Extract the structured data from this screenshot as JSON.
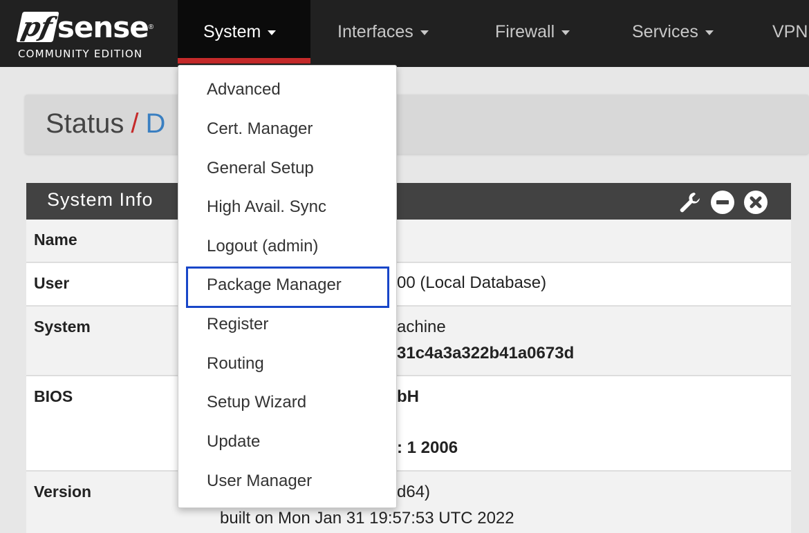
{
  "logo": {
    "pf": "pf",
    "sense": "sense",
    "reg": "®",
    "edition": "COMMUNITY EDITION"
  },
  "nav": {
    "system": "System",
    "interfaces": "Interfaces",
    "firewall": "Firewall",
    "services": "Services",
    "vpn": "VPN"
  },
  "breadcrumb": {
    "section": "Status",
    "separator": "/",
    "current": "D"
  },
  "sysinfo": {
    "title": "System Info",
    "rows": {
      "name": {
        "label": "Name"
      },
      "user": {
        "label": "User",
        "value": "00 (Local Database)"
      },
      "system": {
        "label": "System",
        "value1": "achine",
        "value2": "31c4a3a322b41a0673d"
      },
      "bios": {
        "label": "BIOS",
        "value1": "bH",
        "value2": ": 1 2006"
      },
      "version": {
        "label": "Version",
        "value1": "d64)",
        "value2": "built on Mon Jan 31 19:57:53 UTC 2022"
      }
    }
  },
  "system_menu": {
    "items": [
      "Advanced",
      "Cert. Manager",
      "General Setup",
      "High Avail. Sync",
      "Logout (admin)",
      "Package Manager",
      "Register",
      "Routing",
      "Setup Wizard",
      "Update",
      "User Manager"
    ],
    "highlighted": "Package Manager"
  },
  "icons": {
    "wrench": "wrench-icon",
    "minus": "minus-circle-icon",
    "close": "close-circle-icon"
  },
  "colors": {
    "navbar": "#212121",
    "accent_red": "#c52a2a",
    "link_blue": "#3a7fc1",
    "highlight_box": "#1846c8",
    "panel_header": "#424242"
  }
}
